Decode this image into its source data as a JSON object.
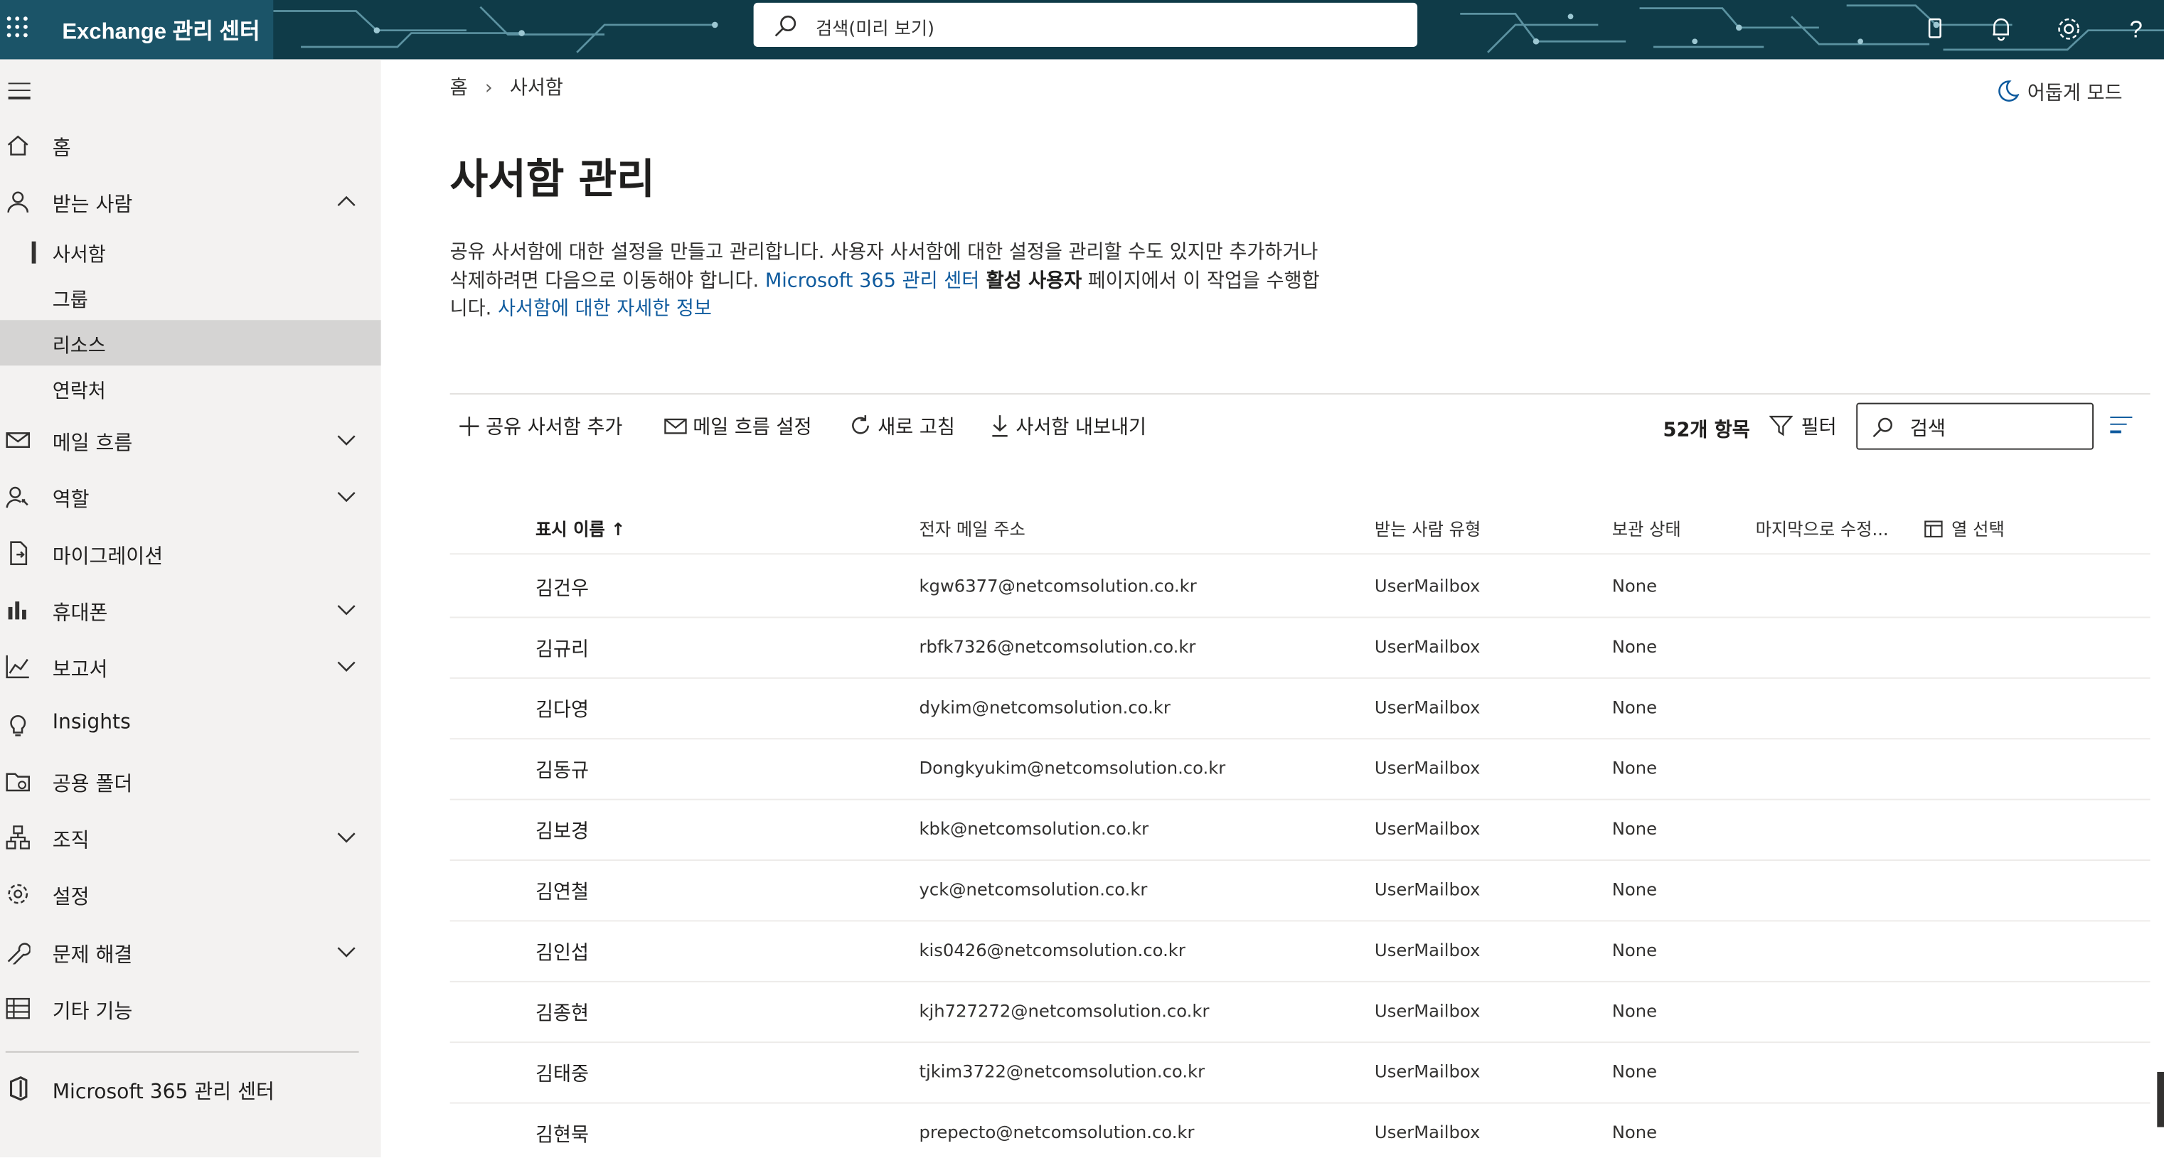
{
  "header": {
    "app_title": "Exchange 관리 센터",
    "search_placeholder": "검색(미리 보기)"
  },
  "sidebar": {
    "items": [
      {
        "label": "홈",
        "icon": "home-icon",
        "expandable": false
      },
      {
        "label": "받는 사람",
        "icon": "person-icon",
        "expandable": true,
        "expanded": true,
        "children": [
          {
            "label": "사서함",
            "active": true
          },
          {
            "label": "그룹",
            "active": false
          },
          {
            "label": "리소스",
            "active": false,
            "highlighted": true
          },
          {
            "label": "연락처",
            "active": false
          }
        ]
      },
      {
        "label": "메일 흐름",
        "icon": "mail-icon",
        "expandable": true
      },
      {
        "label": "역할",
        "icon": "roles-icon",
        "expandable": true
      },
      {
        "label": "마이그레이션",
        "icon": "migration-icon",
        "expandable": false
      },
      {
        "label": "휴대폰",
        "icon": "mobile-icon",
        "expandable": true
      },
      {
        "label": "보고서",
        "icon": "report-icon",
        "expandable": true
      },
      {
        "label": "Insights",
        "icon": "lightbulb-icon",
        "expandable": false
      },
      {
        "label": "공용 폴더",
        "icon": "public-folder-icon",
        "expandable": false
      },
      {
        "label": "조직",
        "icon": "organization-icon",
        "expandable": true
      },
      {
        "label": "설정",
        "icon": "gear-icon",
        "expandable": false
      },
      {
        "label": "문제 해결",
        "icon": "wrench-icon",
        "expandable": true
      },
      {
        "label": "기타 기능",
        "icon": "table-icon",
        "expandable": false
      }
    ],
    "footer_link": "Microsoft 365 관리 센터"
  },
  "breadcrumb": {
    "home": "홈",
    "current": "사서함"
  },
  "dark_mode_label": "어둡게 모드",
  "page": {
    "title": "사서함 관리",
    "desc_1": "공유 사서함에 대한 설정을 만들고 관리합니다. 사용자 사서함에 대한 설정을 관리할 수도 있지만 추가하거나 삭제하려면 다음으로 이동해야 합니다. ",
    "desc_link_1": "Microsoft 365 관리 센터",
    "desc_bold": " 활성 사용자",
    "desc_2": " 페이지에서 이 작업을 수행합니다. ",
    "desc_link_2": "사서함에 대한 자세한 정보"
  },
  "commands": {
    "add_shared": "공유 사서함 추가",
    "mail_flow": "메일 흐름 설정",
    "refresh": "새로 고침",
    "export": "사서함 내보내기",
    "count": "52개 항목",
    "filter": "필터",
    "search_placeholder": "검색"
  },
  "table": {
    "columns": [
      "표시 이름 ↑",
      "전자 메일 주소",
      "받는 사람 유형",
      "보관 상태",
      "마지막으로 수정...",
      "열 선택"
    ],
    "rows": [
      {
        "name": "김건우",
        "email": "kgw6377@netcomsolution.co.kr",
        "type": "UserMailbox",
        "archive": "None"
      },
      {
        "name": "김규리",
        "email": "rbfk7326@netcomsolution.co.kr",
        "type": "UserMailbox",
        "archive": "None"
      },
      {
        "name": "김다영",
        "email": "dykim@netcomsolution.co.kr",
        "type": "UserMailbox",
        "archive": "None"
      },
      {
        "name": "김동규",
        "email": "Dongkyukim@netcomsolution.co.kr",
        "type": "UserMailbox",
        "archive": "None"
      },
      {
        "name": "김보경",
        "email": "kbk@netcomsolution.co.kr",
        "type": "UserMailbox",
        "archive": "None"
      },
      {
        "name": "김연철",
        "email": "yck@netcomsolution.co.kr",
        "type": "UserMailbox",
        "archive": "None"
      },
      {
        "name": "김인섭",
        "email": "kis0426@netcomsolution.co.kr",
        "type": "UserMailbox",
        "archive": "None"
      },
      {
        "name": "김종현",
        "email": "kjh727272@netcomsolution.co.kr",
        "type": "UserMailbox",
        "archive": "None"
      },
      {
        "name": "김태중",
        "email": "tjkim3722@netcomsolution.co.kr",
        "type": "UserMailbox",
        "archive": "None"
      },
      {
        "name": "김현묵",
        "email": "prepecto@netcomsolution.co.kr",
        "type": "UserMailbox",
        "archive": "None"
      }
    ]
  },
  "colors": {
    "topbar": "#0f3b48",
    "link": "#0f5b9e",
    "sidebar": "#f3f2f1"
  }
}
